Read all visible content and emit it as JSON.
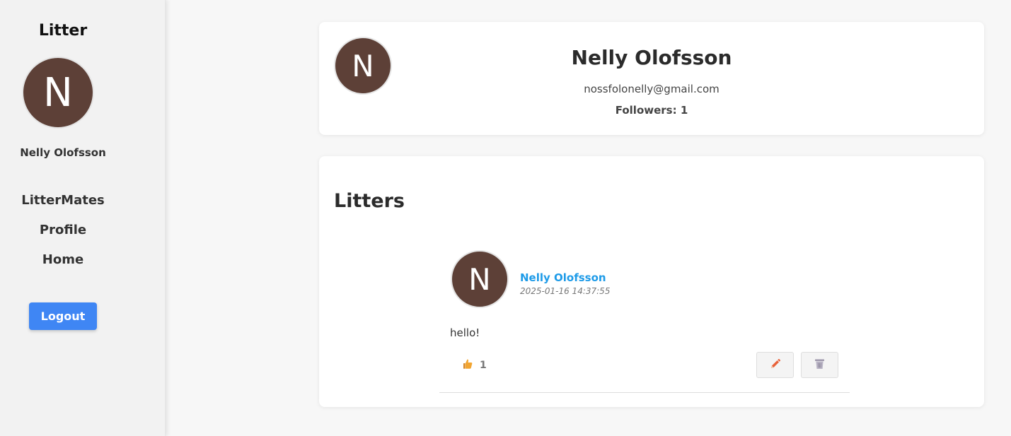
{
  "sidebar": {
    "brand": "Litter",
    "avatar_letter": "N",
    "username": "Nelly Olofsson",
    "nav": [
      "LitterMates",
      "Profile",
      "Home"
    ],
    "logout_label": "Logout"
  },
  "profile": {
    "avatar_letter": "N",
    "name": "Nelly Olofsson",
    "email": "nossfolonelly@gmail.com",
    "followers": "Followers: 1"
  },
  "litters": {
    "title": "Litters",
    "posts": [
      {
        "avatar_letter": "N",
        "author": "Nelly Olofsson",
        "timestamp": "2025-01-16 14:37:55",
        "text": "hello!",
        "likes": "1",
        "like_icon": "thumbs-up-icon",
        "edit_icon": "pencil-icon",
        "delete_icon": "trash-icon"
      }
    ]
  },
  "colors": {
    "avatar_bg": "#5d4037",
    "accent_blue": "#3f86f4",
    "link_blue": "#1e9be8",
    "pencil_orange": "#e8623a"
  }
}
